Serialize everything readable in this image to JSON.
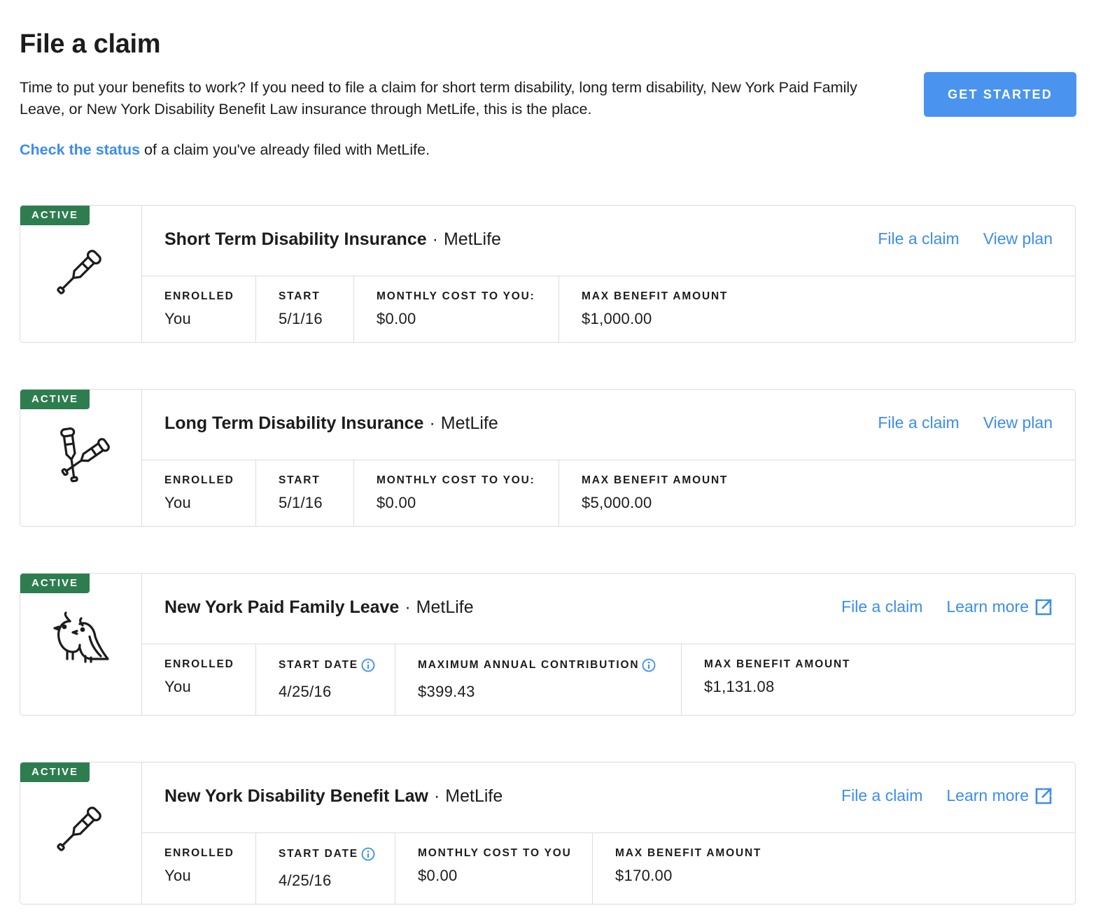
{
  "header": {
    "title": "File a claim",
    "intro": "Time to put your benefits to work? If you need to file a claim for short term disability, long term disability, New York Paid Family Leave, or New York Disability Benefit Law insurance through MetLife, this is the place.",
    "get_started_label": "GET STARTED",
    "status_link": "Check the status",
    "status_rest": " of a claim you've already filed with MetLife."
  },
  "colors": {
    "accent": "#4a94f0",
    "link": "#3b8ded",
    "badge": "#2e7d4f",
    "border": "#dcdcdc"
  },
  "plans": [
    {
      "badge": "ACTIVE",
      "icon": "crutch-icon",
      "name": "Short Term Disability Insurance",
      "dot": "·",
      "provider": "MetLife",
      "action1": "File a claim",
      "action2": "View plan",
      "stats": [
        {
          "label": "ENROLLED",
          "value": "You"
        },
        {
          "label": "START",
          "value": "5/1/16"
        },
        {
          "label": "MONTHLY COST TO YOU:",
          "value": "$0.00"
        },
        {
          "label": "MAX BENEFIT AMOUNT",
          "value": "$1,000.00"
        }
      ]
    },
    {
      "badge": "ACTIVE",
      "icon": "crossed-crutches-icon",
      "name": "Long Term Disability Insurance",
      "dot": "·",
      "provider": "MetLife",
      "action1": "File a claim",
      "action2": "View plan",
      "stats": [
        {
          "label": "ENROLLED",
          "value": "You"
        },
        {
          "label": "START",
          "value": "5/1/16"
        },
        {
          "label": "MONTHLY COST TO YOU:",
          "value": "$0.00"
        },
        {
          "label": "MAX BENEFIT AMOUNT",
          "value": "$5,000.00"
        }
      ]
    },
    {
      "badge": "ACTIVE",
      "icon": "two-birds-icon",
      "name": "New York Paid Family Leave",
      "dot": "·",
      "provider": "MetLife",
      "action1": "File a claim",
      "action2": "Learn more",
      "stats": [
        {
          "label": "ENROLLED",
          "value": "You"
        },
        {
          "label": "START DATE",
          "value": "4/25/16"
        },
        {
          "label": "MAXIMUM ANNUAL CONTRIBUTION",
          "value": "$399.43"
        },
        {
          "label": "MAX BENEFIT AMOUNT",
          "value": "$1,131.08"
        }
      ]
    },
    {
      "badge": "ACTIVE",
      "icon": "crutch-icon",
      "name": "New York Disability Benefit Law",
      "dot": "·",
      "provider": "MetLife",
      "action1": "File a claim",
      "action2": "Learn more",
      "stats": [
        {
          "label": "ENROLLED",
          "value": "You"
        },
        {
          "label": "START DATE",
          "value": "4/25/16"
        },
        {
          "label": "MONTHLY COST TO YOU",
          "value": "$0.00"
        },
        {
          "label": "MAX BENEFIT AMOUNT",
          "value": "$170.00"
        }
      ]
    }
  ]
}
